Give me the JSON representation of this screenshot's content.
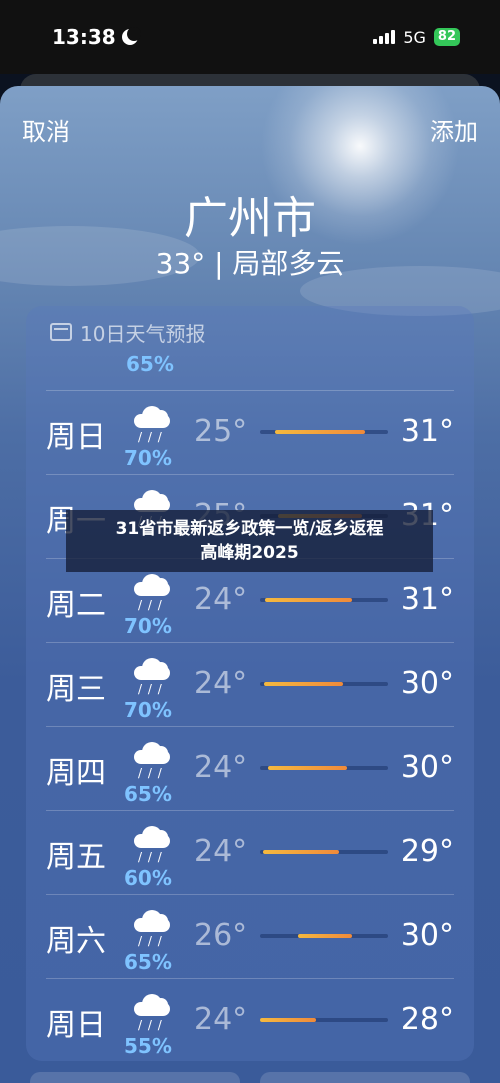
{
  "status_bar": {
    "time": "13:38",
    "network": "5G",
    "battery": "82"
  },
  "nav": {
    "cancel_label": "取消",
    "add_label": "添加"
  },
  "city": "广州市",
  "summary": "33° | 局部多云",
  "forecast": {
    "title": "10日天气预报",
    "cut_percent": "65%",
    "rows": [
      {
        "day": "周日",
        "percent": "70%",
        "low": "25°",
        "high": "31°",
        "bar_start": 0.12,
        "bar_end": 0.82
      },
      {
        "day": "周一",
        "percent": "",
        "low": "25°",
        "high": "31°",
        "bar_start": 0.14,
        "bar_end": 0.8
      },
      {
        "day": "周二",
        "percent": "70%",
        "low": "24°",
        "high": "31°",
        "bar_start": 0.04,
        "bar_end": 0.72
      },
      {
        "day": "周三",
        "percent": "70%",
        "low": "24°",
        "high": "30°",
        "bar_start": 0.03,
        "bar_end": 0.65
      },
      {
        "day": "周四",
        "percent": "65%",
        "low": "24°",
        "high": "30°",
        "bar_start": 0.06,
        "bar_end": 0.68
      },
      {
        "day": "周五",
        "percent": "60%",
        "low": "24°",
        "high": "29°",
        "bar_start": 0.02,
        "bar_end": 0.62
      },
      {
        "day": "周六",
        "percent": "65%",
        "low": "26°",
        "high": "30°",
        "bar_start": 0.3,
        "bar_end": 0.72
      },
      {
        "day": "周日",
        "percent": "55%",
        "low": "24°",
        "high": "28°",
        "bar_start": 0.0,
        "bar_end": 0.44
      }
    ]
  },
  "overlay": {
    "line1": "31省市最新返乡政策一览/返乡返程",
    "line2": "高峰期2025"
  }
}
